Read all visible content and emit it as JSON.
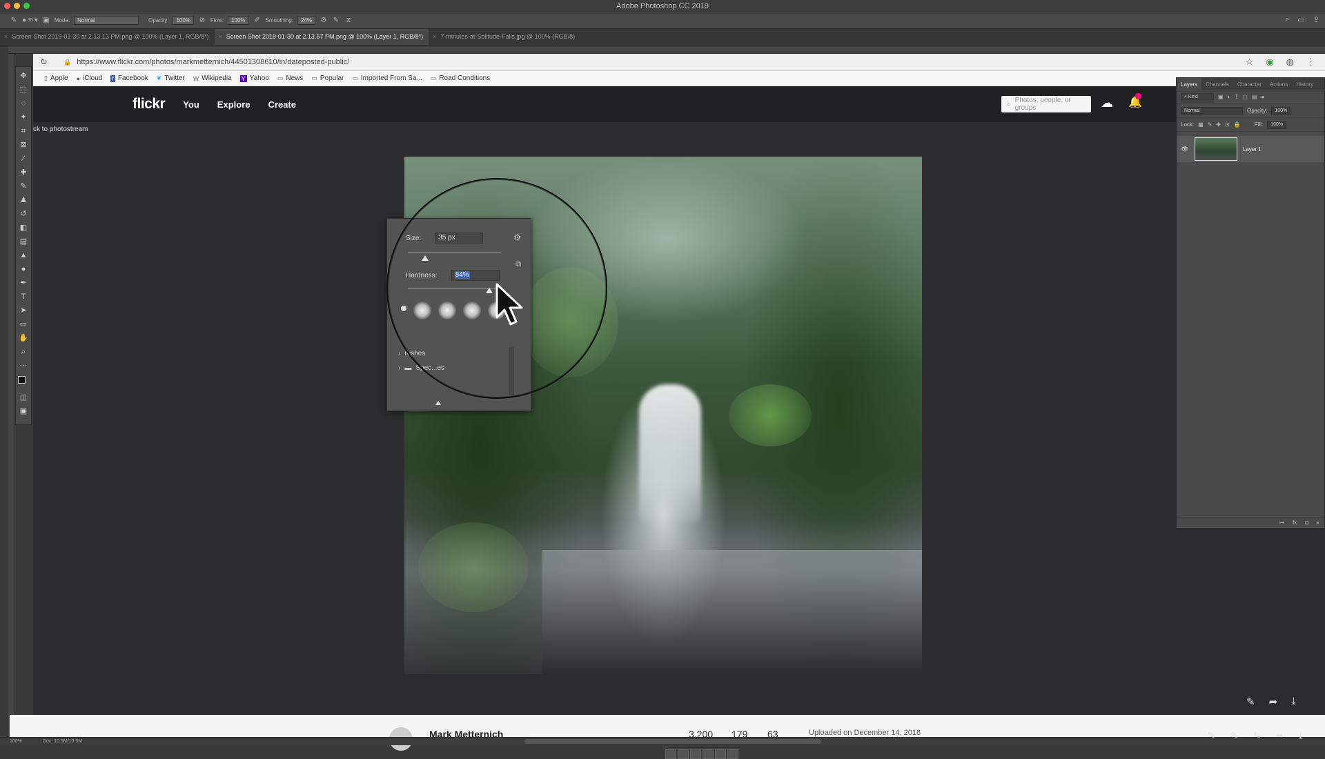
{
  "window": {
    "title": "Adobe Photoshop CC 2019"
  },
  "options_bar": {
    "mode_label": "Mode:",
    "mode_value": "Normal",
    "opacity_label": "Opacity:",
    "opacity_value": "100%",
    "flow_label": "Flow:",
    "flow_value": "100%",
    "smoothing_label": "Smoothing:",
    "smoothing_value": "24%",
    "brush_size_preview": "35"
  },
  "doc_tabs": [
    {
      "label": "Screen Shot 2019-01-30 at 2.13.13 PM.png @ 100% (Layer 1, RGB/8*)"
    },
    {
      "label": "Screen Shot 2019-01-30 at 2.13.57 PM.png @ 100% (Layer 1, RGB/8*)"
    },
    {
      "label": "7-minutes-at-Solitude-Falls.jpg @ 100% (RGB/8)"
    }
  ],
  "browser": {
    "url": "https://www.flickr.com/photos/markmetternich/44501308610/in/dateposted-public/",
    "bookmarks": [
      "Apple",
      "iCloud",
      "Facebook",
      "Twitter",
      "Wikipedia",
      "Yahoo",
      "News",
      "Popular",
      "Imported From Sa...",
      "Road Conditions"
    ]
  },
  "flickr": {
    "logo": "flickr",
    "nav": [
      "You",
      "Explore",
      "Create"
    ],
    "search_placeholder": "Photos, people, or groups",
    "back_link": "ck to photostream",
    "owner": "Mark Metternich",
    "stats": [
      "3,200",
      "179",
      "63"
    ],
    "uploaded": "Uploaded on December 14, 2018"
  },
  "brush_panel": {
    "size_label": "Size:",
    "size_value": "35 px",
    "hardness_label": "Hardness:",
    "hardness_value": "84%",
    "folders": [
      "rushes",
      "Spec...es"
    ]
  },
  "layers_panel": {
    "tabs": [
      "Layers",
      "Channels",
      "Character",
      "Actions",
      "History"
    ],
    "kind_label": "Kind",
    "blend_mode": "Normal",
    "opacity_label": "Opacity:",
    "opacity_value": "100%",
    "lock_label": "Lock:",
    "fill_label": "Fill:",
    "fill_value": "100%",
    "layer_name": "Layer 1"
  },
  "status_bar": {
    "zoom": "100%",
    "doc": "Doc: 10.5M/10.5M"
  },
  "colors": {
    "flickr_nav": "#212124",
    "flickr_badge": "#ff0084",
    "selection": "#3b63b8"
  }
}
